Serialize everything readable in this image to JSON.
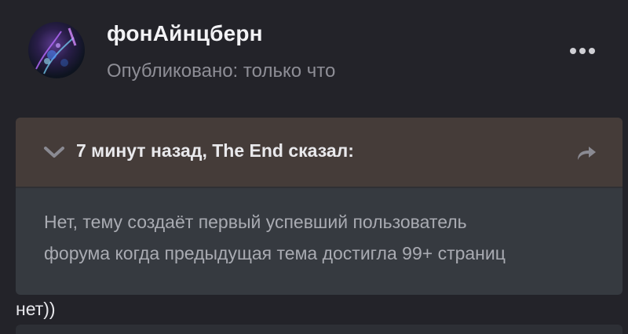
{
  "post": {
    "author": "фонАйнцберн",
    "meta": "Опубликовано: только что",
    "more_icon": "ellipsis-icon",
    "text": "нет))"
  },
  "quote": {
    "citation": "7 минут назад, The End сказал:",
    "toggle_icon": "chevron-down-icon",
    "goto_icon": "share-arrow-icon",
    "lines": [
      "Нет, тему создаёт первый успевший пользователь",
      "форума когда предыдущая тема достигла 99+ страниц"
    ]
  },
  "colors": {
    "background": "#232329",
    "quote_header": "#453c39",
    "quote_body": "#363a40",
    "muted_text": "#8e8e96"
  }
}
